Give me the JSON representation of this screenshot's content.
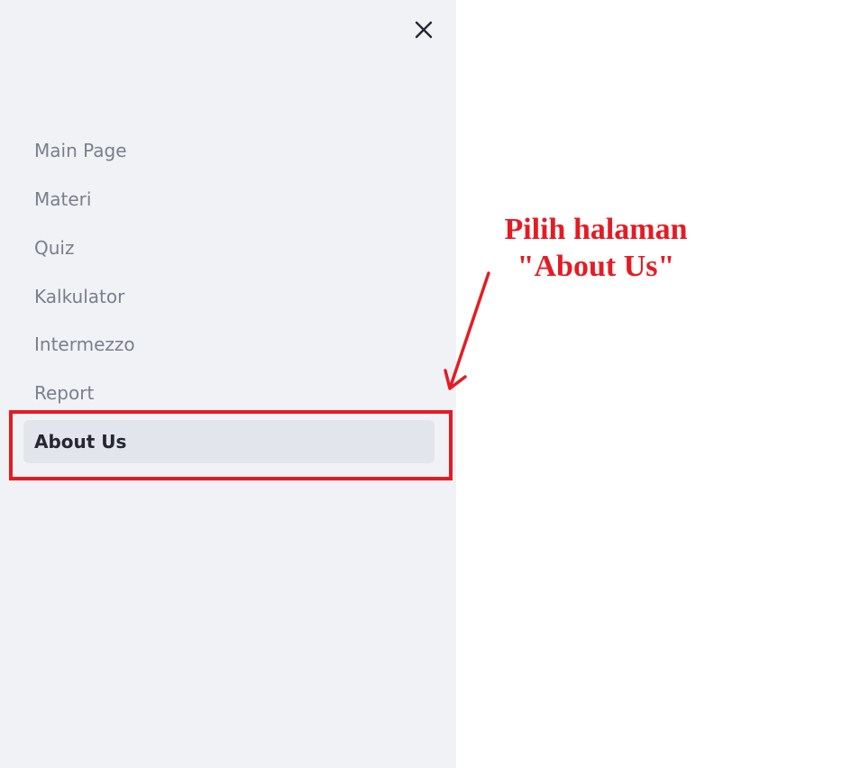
{
  "sidebar": {
    "close_icon": "close-icon",
    "items": [
      {
        "label": "Main Page",
        "active": false
      },
      {
        "label": "Materi",
        "active": false
      },
      {
        "label": "Quiz",
        "active": false
      },
      {
        "label": "Kalkulator",
        "active": false
      },
      {
        "label": "Intermezzo",
        "active": false
      },
      {
        "label": "Report",
        "active": false
      },
      {
        "label": "About Us",
        "active": true
      }
    ]
  },
  "annotation": {
    "line1": "Pilih halaman",
    "line2": "\"About Us\"",
    "color": "#e51b23"
  },
  "colors": {
    "sidebar_bg": "#f0f2f6",
    "active_bg": "#e2e5ec",
    "inactive_text": "#7a7f8c",
    "active_text": "#262730"
  }
}
